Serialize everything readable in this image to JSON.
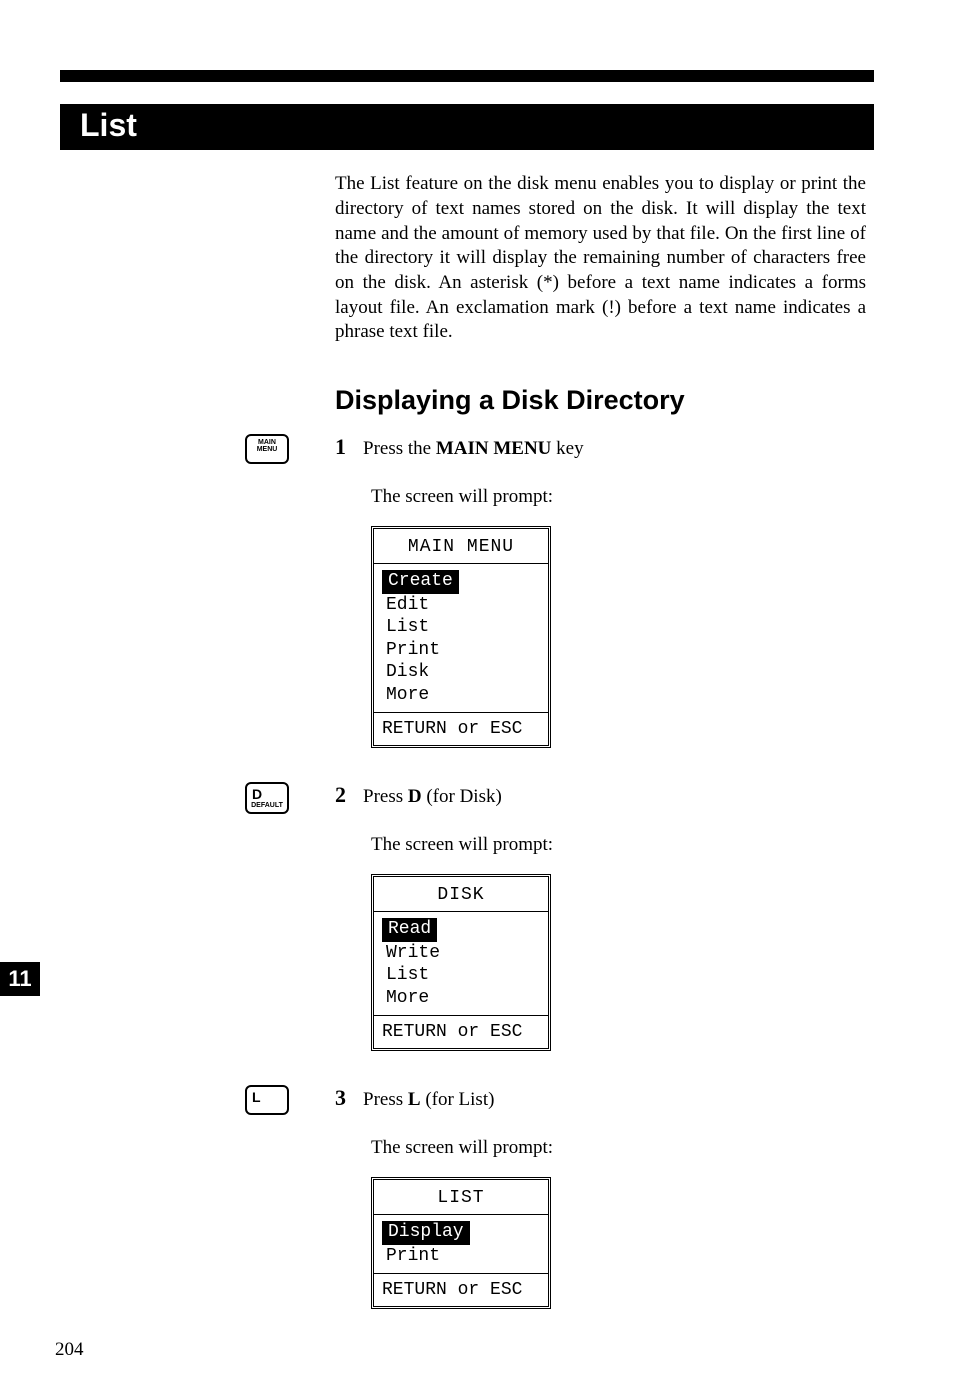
{
  "section_title": "List",
  "intro_text": "The List feature on the disk menu enables you to display or print the directory of text names stored on the disk. It will display the text name and the amount of memory used by that file. On the first line of the directory it will display the remaining number of characters free on the disk. An asterisk (*) before a text name indicates a forms layout file. An exclamation mark (!) before a text name indicates a phrase text file.",
  "subheading": "Displaying a Disk Directory",
  "chapter_tab": "11",
  "page_number": "204",
  "steps": [
    {
      "num": "1",
      "key_label_line1": "MAIN",
      "key_label_line2": "MENU",
      "text_pre": "Press the ",
      "text_bold": "MAIN MENU",
      "text_post": " key",
      "prompt": "The screen will prompt:",
      "menu": {
        "title": "MAIN MENU",
        "items": [
          "Create",
          "Edit",
          "List",
          "Print",
          "Disk",
          "More"
        ],
        "selected_index": 0,
        "footer": "RETURN or ESC"
      }
    },
    {
      "num": "2",
      "key_label_line1": "D",
      "key_label_line2": "DEFAULT",
      "text_pre": "Press ",
      "text_bold": "D",
      "text_post": " (for Disk)",
      "prompt": "The screen will prompt:",
      "menu": {
        "title": "DISK",
        "items": [
          "Read",
          "Write",
          "List",
          "More"
        ],
        "selected_index": 0,
        "footer": "RETURN or ESC"
      }
    },
    {
      "num": "3",
      "key_label_line1": "L",
      "key_label_line2": "",
      "text_pre": "Press ",
      "text_bold": "L",
      "text_post": " (for List)",
      "prompt": "The screen will prompt:",
      "menu": {
        "title": "LIST",
        "items": [
          "Display",
          "Print"
        ],
        "selected_index": 0,
        "footer": "RETURN or ESC"
      }
    }
  ]
}
